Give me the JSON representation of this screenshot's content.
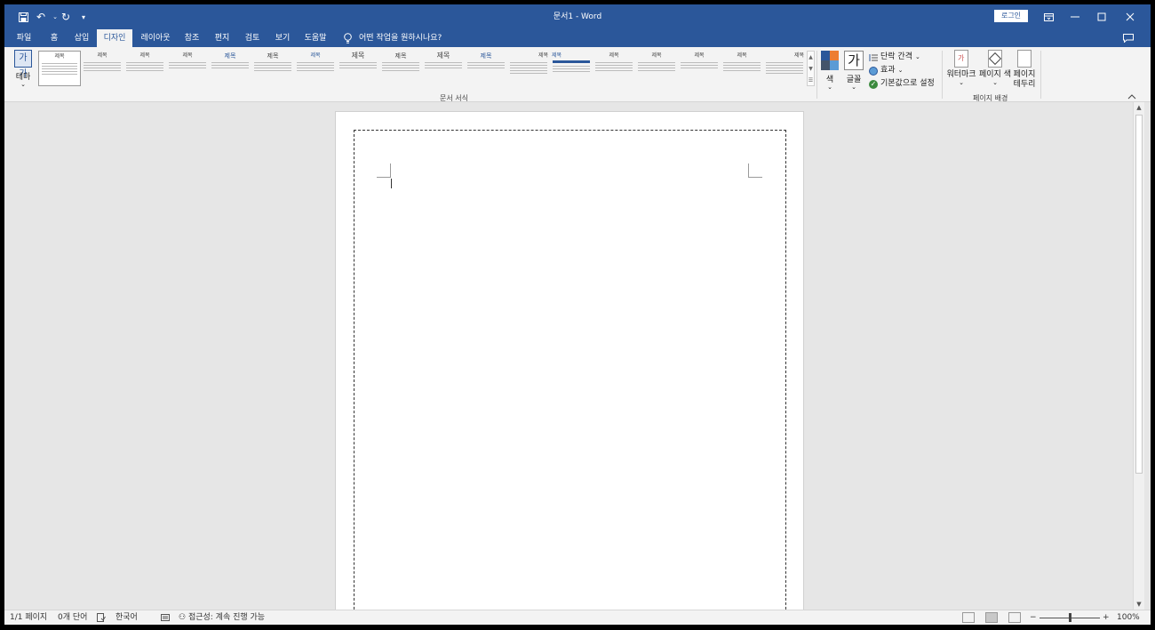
{
  "title_bar": {
    "doc_title": "문서1  -  Word",
    "login_label": "로그인",
    "qat_icons": [
      "save-icon",
      "undo-icon",
      "redo-icon",
      "customize-icon"
    ]
  },
  "tabs": [
    {
      "label": "파일"
    },
    {
      "label": "홈"
    },
    {
      "label": "삽입"
    },
    {
      "label": "디자인",
      "active": true
    },
    {
      "label": "레이아웃"
    },
    {
      "label": "참조"
    },
    {
      "label": "편지"
    },
    {
      "label": "검토"
    },
    {
      "label": "보기"
    },
    {
      "label": "도움말"
    }
  ],
  "tell_me": "어떤 작업을 원하시나요?",
  "ribbon": {
    "theme_label": "테마",
    "theme_thumb": "가가",
    "style_gallery": [
      "제목",
      "제목",
      "제목",
      "제목",
      "제목",
      "제목",
      "제목",
      "제목",
      "제목",
      "제목",
      "제목",
      "제목",
      "제목",
      "제목",
      "제목",
      "제목",
      "제목",
      "제목"
    ],
    "doc_format_label": "문서 서식",
    "colors_label": "색",
    "fonts_label": "글꼴",
    "fonts_glyph": "가",
    "paragraph_spacing": "단락 간격",
    "effects": "효과",
    "set_default": "기본값으로 설정",
    "watermark": "워터마크",
    "page_color": "페이지 색",
    "page_borders_line1": "페이지",
    "page_borders_line2": "테두리",
    "page_bg_label": "페이지 배경"
  },
  "status": {
    "page": "1/1 페이지",
    "words": "0개 단어",
    "language": "한국어",
    "accessibility": "접근성: 계속 진행 가능",
    "zoom": "100%"
  },
  "colors": {
    "title_bar": "#2b579a",
    "ribbon": "#f3f3f3",
    "canvas": "#e6e6e6"
  }
}
